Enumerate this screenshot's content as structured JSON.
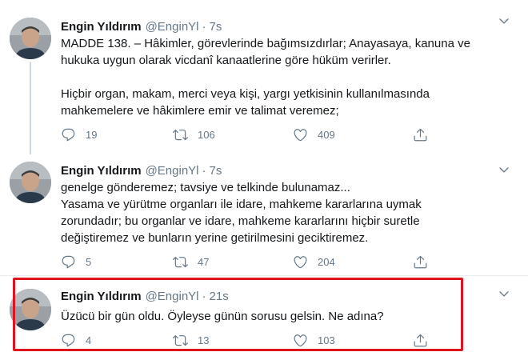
{
  "tweets": [
    {
      "name": "Engin Yıldırım",
      "handle": "@EnginYl",
      "dot": "·",
      "time": "7s",
      "text": "MADDE 138. – Hâkimler, görevlerinde bağımsızdırlar; Anayasaya, kanuna ve\nhukuka uygun olarak vicdanî kanaatlerine göre hüküm verirler.\n\nHiçbir organ, makam, merci veya kişi, yargı yetkisinin kullanılmasında\nmahkemelere ve hâkimlere emir ve talimat veremez;",
      "replies": "19",
      "retweets": "106",
      "likes": "409"
    },
    {
      "name": "Engin Yıldırım",
      "handle": "@EnginYl",
      "dot": "·",
      "time": "7s",
      "text": "genelge gönderemez; tavsiye ve telkinde bulunamaz...\nYasama ve yürütme organları ile idare, mahkeme kararlarına uymak\nzorundadır; bu organlar ve idare, mahkeme kararlarını hiçbir suretle\ndeğiştiremez ve bunların yerine getirilmesini geciktiremez.",
      "replies": "5",
      "retweets": "47",
      "likes": "204"
    },
    {
      "name": "Engin Yıldırım",
      "handle": "@EnginYl",
      "dot": "·",
      "time": "21s",
      "text": "Üzücü bir gün oldu. Öyleyse günün sorusu gelsin. Ne adına?",
      "replies": "4",
      "retweets": "13",
      "likes": "103"
    }
  ],
  "icons": {
    "reply": "reply-icon",
    "retweet": "retweet-icon",
    "like": "heart-icon",
    "share": "share-icon",
    "menu": "chevron-down-icon"
  },
  "colors": {
    "text": "#14171a",
    "secondary": "#657786",
    "thread_line": "#ccd6dd",
    "separator": "#e6ecf0",
    "highlight": "#e0141e"
  }
}
